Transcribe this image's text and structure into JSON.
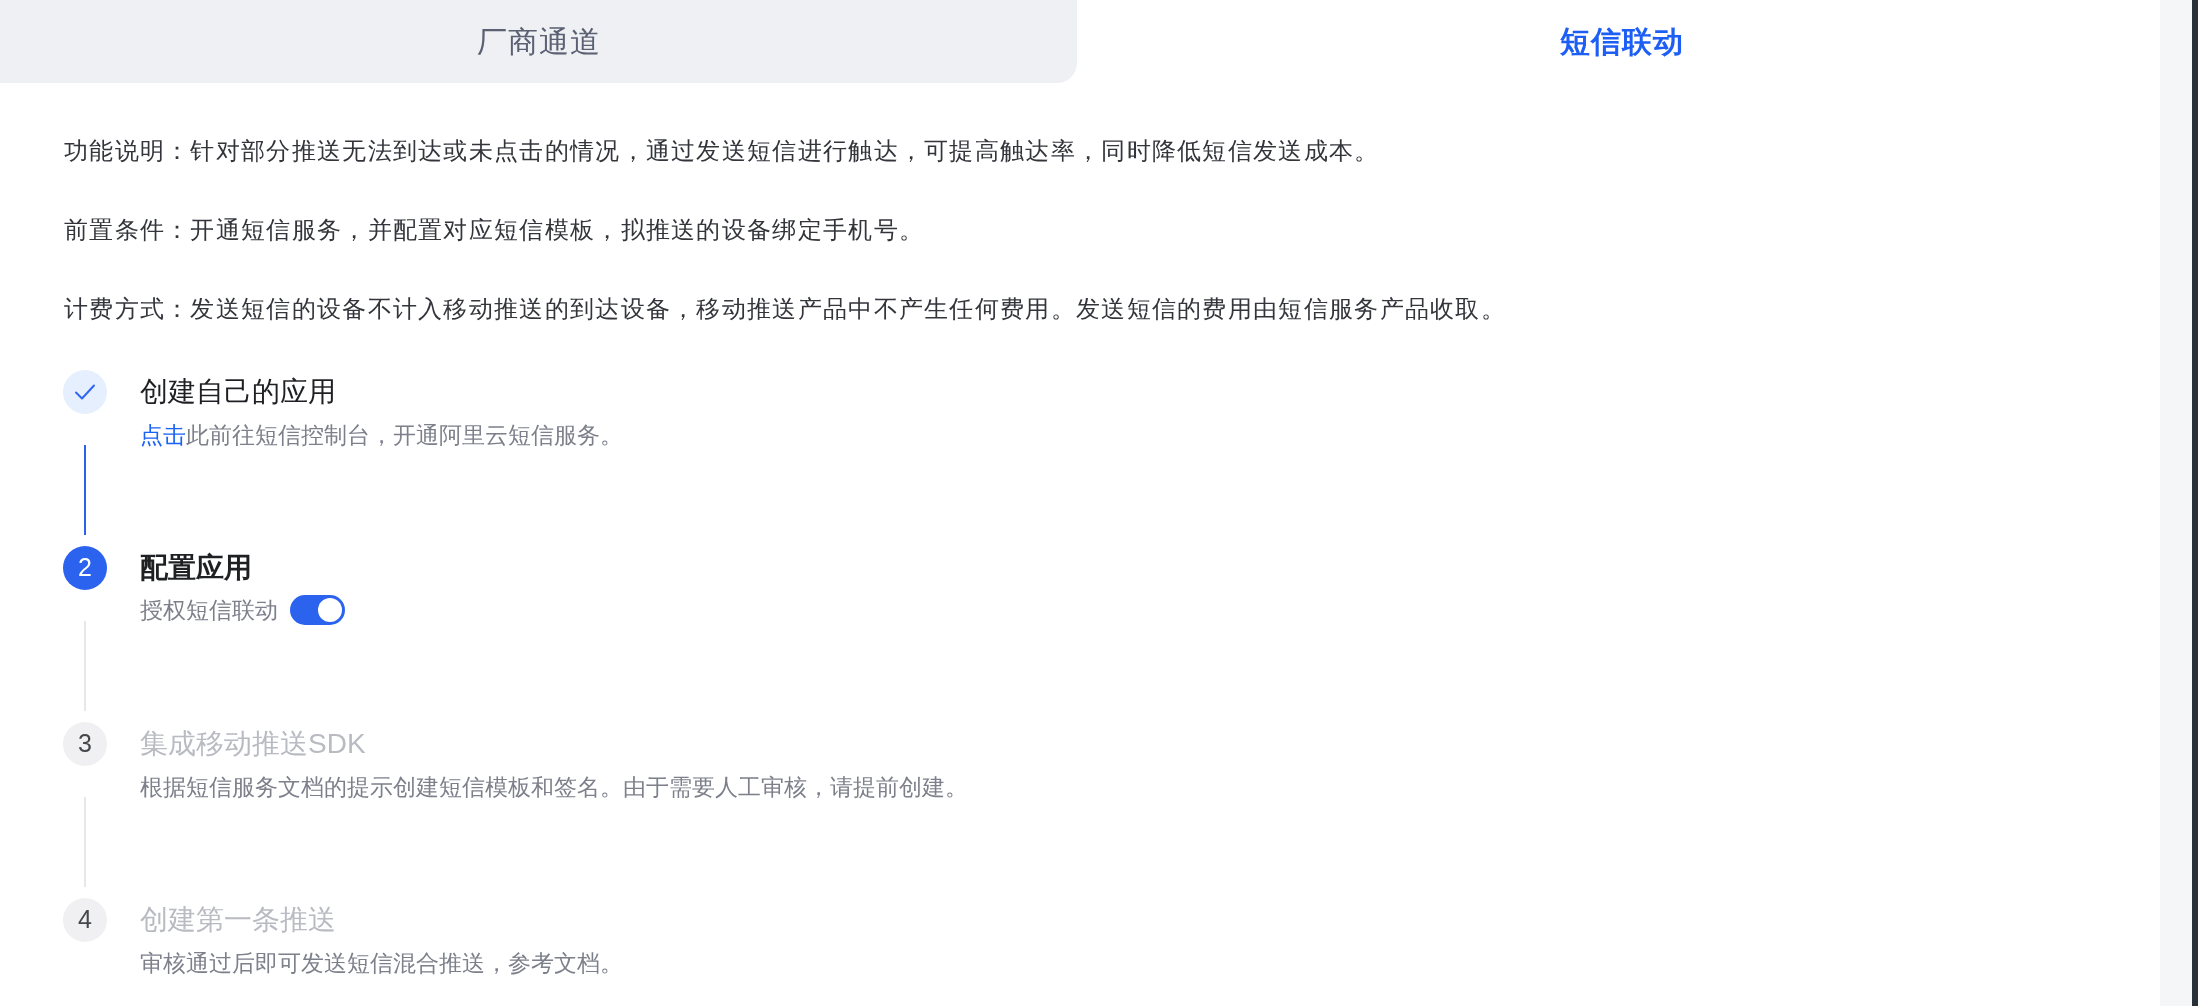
{
  "tabs": [
    {
      "label": "厂商通道",
      "selected": false
    },
    {
      "label": "短信联动",
      "selected": true
    }
  ],
  "intro": [
    "功能说明：针对部分推送无法到达或未点击的情况，通过发送短信进行触达，可提高触达率，同时降低短信发送成本。",
    "前置条件：开通短信服务，并配置对应短信模板，拟推送的设备绑定手机号。",
    "计费方式：发送短信的设备不计入移动推送的到达设备，移动推送产品中不产生任何费用。发送短信的费用由短信服务产品收取。"
  ],
  "steps": [
    {
      "done": true,
      "current": false,
      "kind": "text",
      "title": "创建自己的应用",
      "description": {
        "link": "点击",
        "text": "此前往短信控制台，开通阿里云短信服务。"
      }
    },
    {
      "done": false,
      "current": true,
      "kind": "toggle",
      "number": "2",
      "title": "配置应用",
      "switch": {
        "label": "授权短信联动",
        "on": true
      }
    },
    {
      "done": false,
      "current": false,
      "kind": "text",
      "number": "3",
      "title": "集成移动推送SDK",
      "description": {
        "text": "根据短信服务文档的提示创建短信模板和签名。由于需要人工审核，请提前创建。"
      }
    },
    {
      "done": false,
      "current": false,
      "kind": "text",
      "number": "4",
      "title": "创建第一条推送",
      "description": {
        "text": "审核通过后即可发送短信混合推送，参考文档。"
      }
    }
  ]
}
